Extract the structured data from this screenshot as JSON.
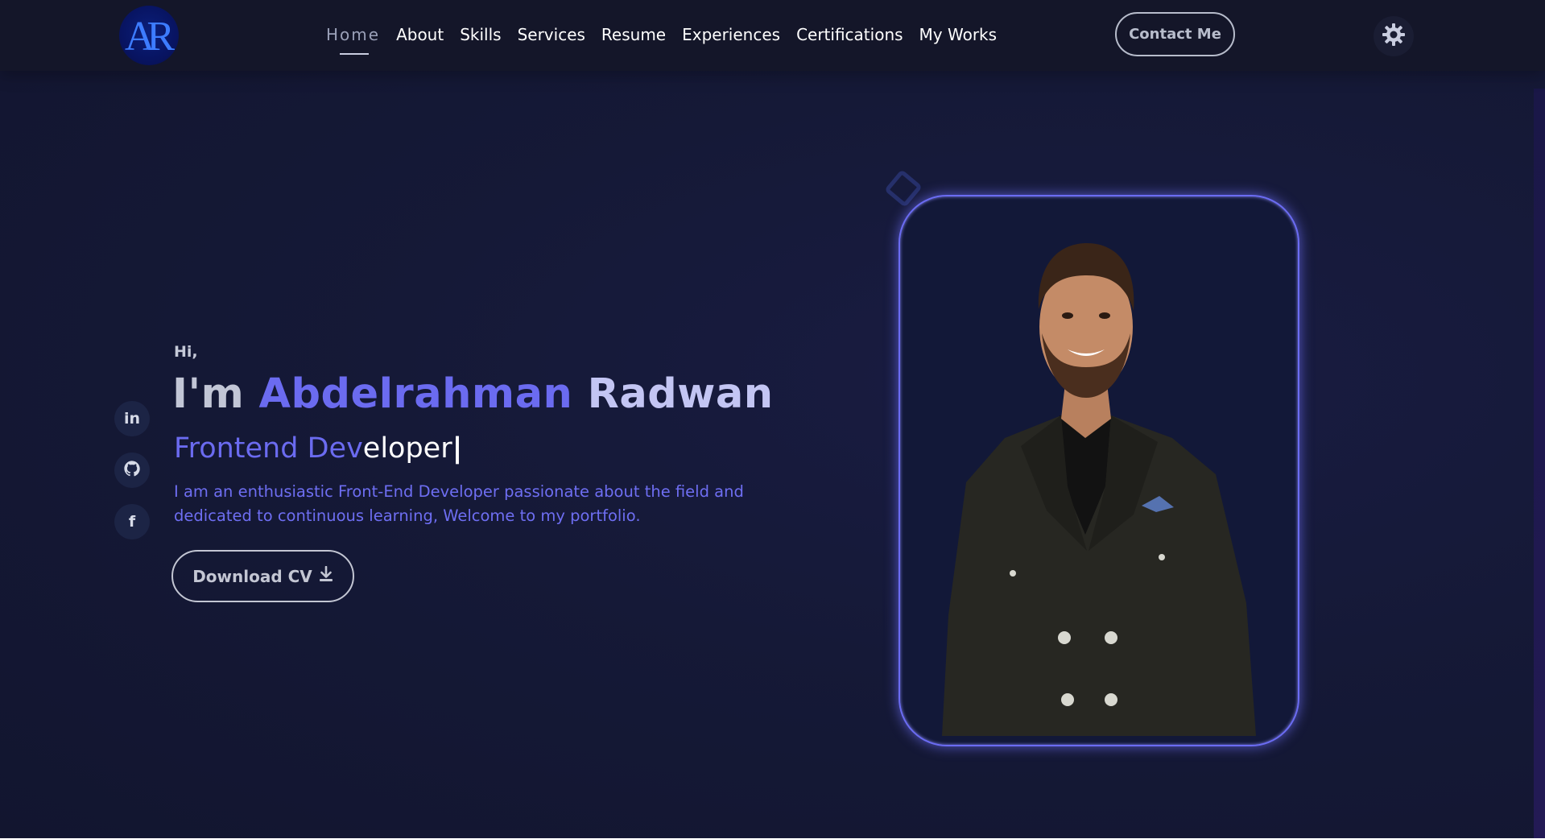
{
  "nav": {
    "logo_text": "AR",
    "links": [
      {
        "label": "Home"
      },
      {
        "label": "About"
      },
      {
        "label": "Skills"
      },
      {
        "label": "Services"
      },
      {
        "label": "Resume"
      },
      {
        "label": "Experiences"
      },
      {
        "label": "Certifications"
      },
      {
        "label": "My Works"
      }
    ],
    "active_link": "Home",
    "contact_label": "Contact Me",
    "theme_icon": "gear-icon"
  },
  "socials": [
    {
      "icon": "linkedin-icon",
      "glyph": "in"
    },
    {
      "icon": "github-icon"
    },
    {
      "icon": "facebook-icon",
      "glyph": "f"
    }
  ],
  "hero": {
    "greeting": "Hi,",
    "intro_prefix": "I'm",
    "first_name": "Abdelrahman",
    "last_name": "Radwan",
    "role_highlighted": "Frontend Dev",
    "role_plain": "eloper",
    "cursor": "|",
    "bio": "I am an enthusiastic Front-End Developer passionate about the field and dedicated to continuous learning, Welcome to my portfolio.",
    "cv_label": "Download CV"
  },
  "colors": {
    "accent": "#6b6bf0",
    "background": "#151937",
    "navbar": "#141629"
  }
}
